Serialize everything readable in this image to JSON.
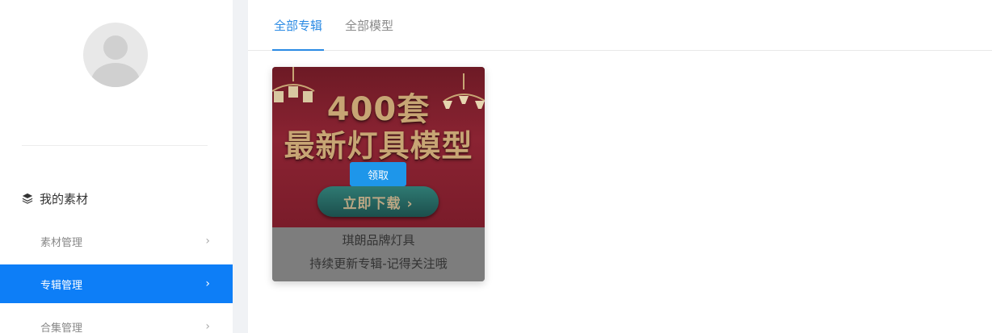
{
  "sidebar": {
    "avatar_icon": "user-avatar-icon",
    "section": {
      "icon": "layers-icon",
      "title": "我的素材"
    },
    "items": [
      {
        "label": "素材管理",
        "chevron": "›",
        "active": false
      },
      {
        "label": "专辑管理",
        "chevron": "›",
        "active": true
      },
      {
        "label": "合集管理",
        "chevron": "›",
        "active": false
      }
    ]
  },
  "tabs": [
    {
      "label": "全部专辑",
      "active": true
    },
    {
      "label": "全部模型",
      "active": false
    }
  ],
  "album": {
    "banner_line1": "400套",
    "banner_line2": "最新灯具模型",
    "banner_button": "立即下载 ›",
    "claim_button": "领取",
    "name": "琪朗品牌灯具",
    "description": "持续更新专辑-记得关注哦"
  },
  "colors": {
    "accent": "#0d7ef7",
    "tab_active": "#2a8ae4",
    "claim_button": "#1e96ea",
    "banner_bg": "#8a2332",
    "banner_text": "#c7a574"
  }
}
